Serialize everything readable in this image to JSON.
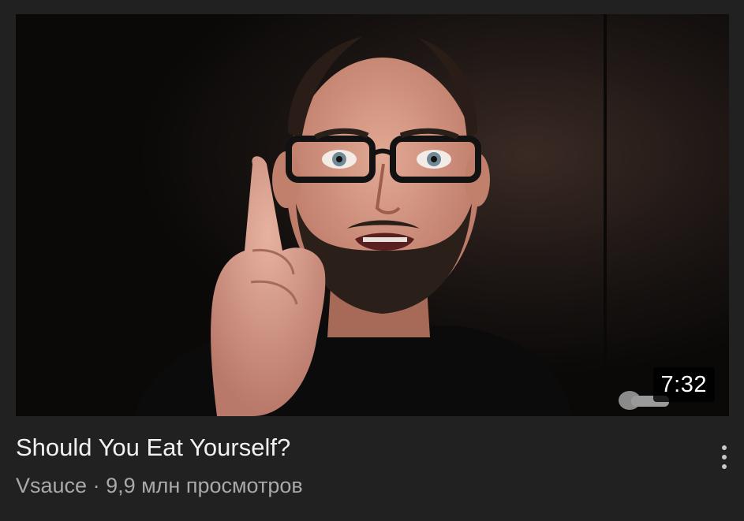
{
  "video": {
    "title": "Should You Eat Yourself?",
    "duration": "7:32",
    "channel": "Vsauce",
    "separator": " · ",
    "views": "9,9 млн просмотров"
  },
  "icons": {
    "more": "more-vert-icon"
  },
  "colors": {
    "background": "#212121",
    "title_text": "#f1f1f1",
    "secondary_text": "#a9a9a9",
    "duration_badge_bg": "#000000"
  }
}
